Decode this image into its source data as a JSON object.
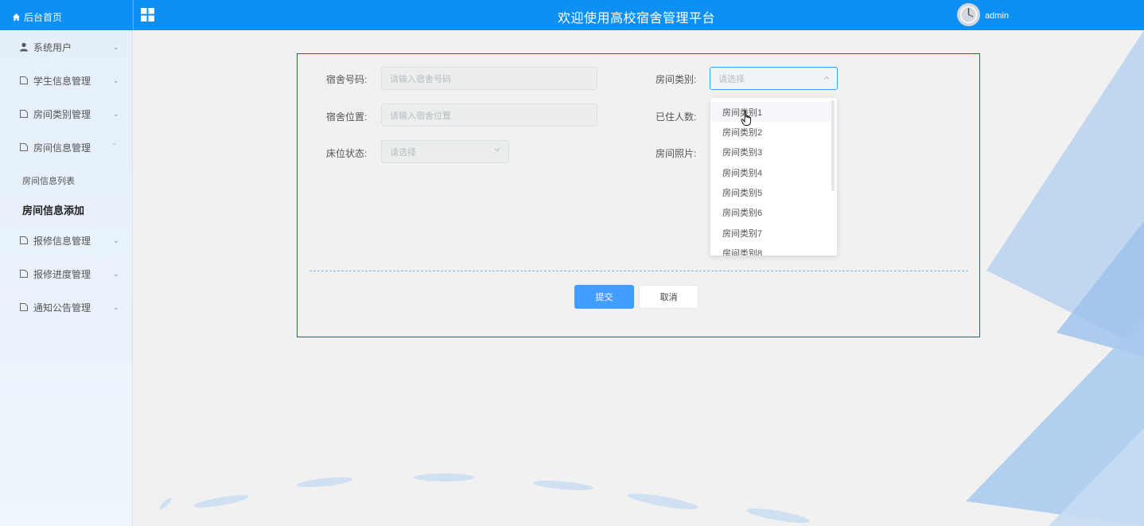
{
  "header": {
    "home_label": "后台首页",
    "title": "欢迎使用高校宿舍管理平台",
    "username": "admin",
    "color": "#0d8ff4"
  },
  "sidebar": {
    "items": [
      {
        "label": "系统用户",
        "icon": "user-icon",
        "expanded": false
      },
      {
        "label": "学生信息管理",
        "icon": "doc-icon",
        "expanded": false
      },
      {
        "label": "房间类别管理",
        "icon": "doc-icon",
        "expanded": false
      },
      {
        "label": "房间信息管理",
        "icon": "doc-icon",
        "expanded": true
      },
      {
        "label": "报修信息管理",
        "icon": "doc-icon",
        "expanded": false
      },
      {
        "label": "报修进度管理",
        "icon": "doc-icon",
        "expanded": false
      },
      {
        "label": "通知公告管理",
        "icon": "doc-icon",
        "expanded": false
      }
    ],
    "subitems": [
      {
        "label": "房间信息列表"
      },
      {
        "label": "房间信息添加",
        "active": true
      }
    ]
  },
  "form": {
    "dorm_number": {
      "label": "宿舍号码:",
      "placeholder": "请输入宿舍号码"
    },
    "dorm_location": {
      "label": "宿舍位置:",
      "placeholder": "请输入宿舍位置"
    },
    "bed_status": {
      "label": "床位状态:",
      "placeholder": "请选择"
    },
    "room_category": {
      "label": "房间类别:",
      "placeholder": "请选择"
    },
    "occupants": {
      "label": "已住人数:"
    },
    "room_photo": {
      "label": "房间照片:"
    },
    "submit_label": "提交",
    "cancel_label": "取消"
  },
  "dropdown": {
    "options": [
      "房间类别1",
      "房间类别2",
      "房间类别3",
      "房间类别4",
      "房间类别5",
      "房间类别6",
      "房间类别7",
      "房间类别8"
    ],
    "hovered_index": 0
  },
  "colors": {
    "accent": "#409eff",
    "panel_border": "#1c5fb0"
  }
}
